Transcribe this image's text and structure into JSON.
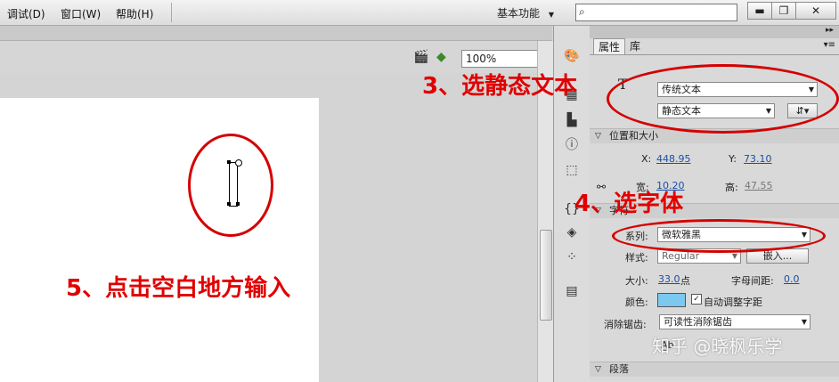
{
  "menu": {
    "debug": "调试(D)",
    "window": "窗口(W)",
    "help": "帮助(H)"
  },
  "workspace": {
    "label": "基本功能",
    "arrow": "▼"
  },
  "search": {
    "icon": "search-icon"
  },
  "window_controls": {
    "minimize": "▬",
    "restore": "❐",
    "close": "✕"
  },
  "toolbar": {
    "zoom_value": "100%"
  },
  "panel": {
    "tab_properties": "属性",
    "tab_library": "库",
    "text_tool_glyph": "T",
    "text_engine": "传统文本",
    "text_type": "静态文本",
    "section_position": "位置和大小",
    "x_label": "X:",
    "x_value": "448.95",
    "y_label": "Y:",
    "y_value": "73.10",
    "width_label": "宽:",
    "width_value": "10.20",
    "height_label": "高:",
    "height_value": "47.55",
    "section_char": "字符",
    "family_label": "系列:",
    "family_value": "微软雅黑",
    "style_label": "样式:",
    "style_value": "Regular",
    "embed_button": "嵌入...",
    "size_label": "大小:",
    "size_value": "33.0",
    "size_unit": "点",
    "spacing_label": "字母间距:",
    "spacing_value": "0.0",
    "color_label": "颜色:",
    "color_swatch": "#7cc8ef",
    "auto_kern_label": "自动调整字距",
    "antialias_label": "消除锯齿:",
    "antialias_value": "可读性消除锯齿",
    "section_paragraph": "段落"
  },
  "annotations": {
    "step3": "3、选静态文本",
    "step4": "4、选字体",
    "step5": "5、点击空白地方输入",
    "color": "#e00000"
  },
  "watermark": "知乎 @晓枫乐学"
}
